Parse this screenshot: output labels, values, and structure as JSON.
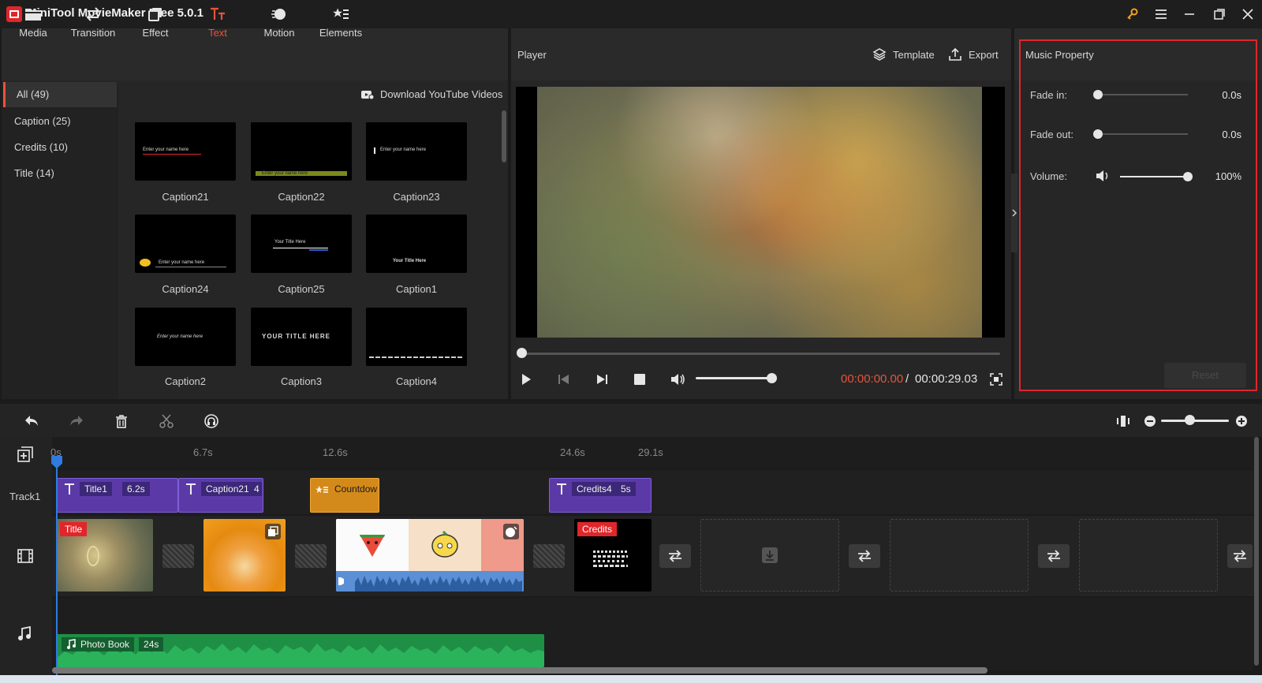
{
  "app": {
    "title": "MiniTool MovieMaker Free 5.0.1"
  },
  "toolbar": {
    "tabs": [
      {
        "label": "Media",
        "icon": "folder-icon"
      },
      {
        "label": "Transition",
        "icon": "transition-arrows-icon"
      },
      {
        "label": "Effect",
        "icon": "effect-layers-icon"
      },
      {
        "label": "Text",
        "icon": "text-tt-icon",
        "active": true
      },
      {
        "label": "Motion",
        "icon": "motion-ball-icon"
      },
      {
        "label": "Elements",
        "icon": "elements-shapes-icon"
      }
    ]
  },
  "categories": [
    {
      "label": "All (49)",
      "active": true
    },
    {
      "label": "Caption (25)"
    },
    {
      "label": "Credits (10)"
    },
    {
      "label": "Title (14)"
    }
  ],
  "download_label": "Download YouTube Videos",
  "thumbnails": [
    {
      "label": "Caption21",
      "text": "Enter your name here"
    },
    {
      "label": "Caption22",
      "text": "Enter your name here"
    },
    {
      "label": "Caption23",
      "text": "Enter your name here"
    },
    {
      "label": "Caption24",
      "text": "Enter your name here"
    },
    {
      "label": "Caption25",
      "text": "Your Title Here"
    },
    {
      "label": "Caption1",
      "text": "Your Title Here"
    },
    {
      "label": "Caption2",
      "text": "Enter your name here"
    },
    {
      "label": "Caption3",
      "text": "YOUR TITLE HERE"
    },
    {
      "label": "Caption4",
      "text": ""
    }
  ],
  "player": {
    "title": "Player",
    "template_label": "Template",
    "export_label": "Export",
    "time_current": "00:00:00.00",
    "time_separator": "/",
    "time_total": "00:00:29.03",
    "seek_fraction": 0,
    "volume_fraction": 1.0
  },
  "music_property": {
    "title": "Music Property",
    "fade_in_label": "Fade in:",
    "fade_in_value": "0.0s",
    "fade_out_label": "Fade out:",
    "fade_out_value": "0.0s",
    "volume_label": "Volume:",
    "volume_value": "100%",
    "reset_label": "Reset"
  },
  "timeline": {
    "ruler": [
      "0s",
      "6.7s",
      "12.6s",
      "24.6s",
      "29.1s"
    ],
    "track1_label": "Track1",
    "title_clips": [
      {
        "name": "Title1",
        "duration": "6.2s"
      },
      {
        "name": "Caption21",
        "duration": "4"
      },
      {
        "name": "Countdow",
        "duration": ""
      },
      {
        "name": "Credits4",
        "duration": "5s"
      }
    ],
    "video_badges": {
      "title": "Title",
      "credits": "Credits"
    },
    "credits_text": "",
    "audio_clip": {
      "name": "Photo Book",
      "duration": "24s"
    },
    "zoom_fraction": 0.45
  },
  "colors": {
    "accent": "#e8533d",
    "highlight_border": "#e0262b",
    "title_clip": "#5b3aa8",
    "countdown_clip": "#d48a1a",
    "audio_clip": "#1f8f46",
    "playhead": "#2f7be0"
  }
}
